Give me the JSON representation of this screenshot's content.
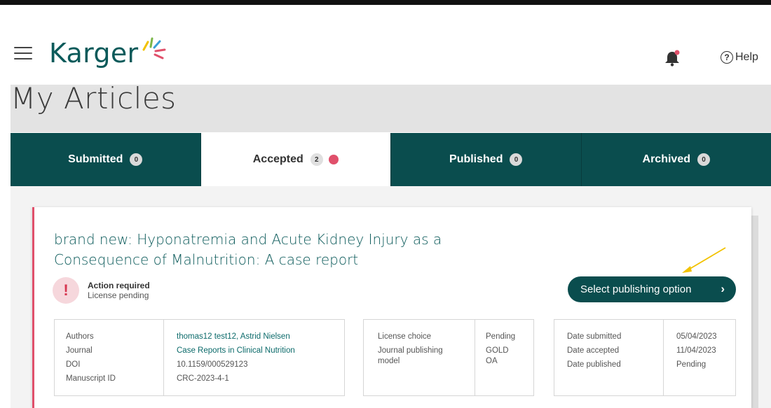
{
  "header": {
    "logo_text": "Karger",
    "help_label": "Help",
    "help_icon": "?"
  },
  "page": {
    "title": "My Articles"
  },
  "tabs": [
    {
      "label": "Submitted",
      "count": "0",
      "active": false
    },
    {
      "label": "Accepted",
      "count": "2",
      "active": true
    },
    {
      "label": "Published",
      "count": "0",
      "active": false
    },
    {
      "label": "Archived",
      "count": "0",
      "active": false
    }
  ],
  "article": {
    "title": "brand new: Hyponatremia and Acute Kidney Injury as a Consequence of Malnutrition: A case report",
    "alert": {
      "icon": "!",
      "title": "Action required",
      "subtitle": "License pending"
    },
    "cta_label": "Select publishing option",
    "cta_icon": "›",
    "details": {
      "labels": [
        "Authors",
        "Journal",
        "DOI",
        "Manuscript ID"
      ],
      "values": [
        "thomas12 test12, Astrid Nielsen",
        "Case Reports in Clinical Nutrition",
        "10.1159/000529123",
        "CRC-2023-4-1"
      ]
    },
    "license": {
      "label_1": "License choice",
      "label_2": "Journal publishing",
      "label_3": "model",
      "value_1": "Pending",
      "value_2": "GOLD",
      "value_3": "OA"
    },
    "dates": {
      "labels": [
        "Date submitted",
        "Date accepted",
        "Date published"
      ],
      "values": [
        "05/04/2023",
        "11/04/2023",
        "Pending"
      ]
    }
  },
  "colors": {
    "brand": "#0a4d4e",
    "accent": "#e0506b",
    "annotation_arrow": "#f2c200"
  }
}
